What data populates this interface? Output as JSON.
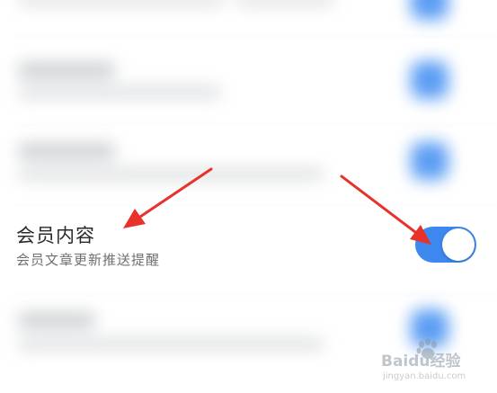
{
  "setting": {
    "title": "会员内容",
    "subtitle": "会员文章更新推送提醒",
    "enabled": true
  },
  "watermark": {
    "text": "Baidu经验",
    "subtext": "jingyan.baidu.com"
  },
  "colors": {
    "toggle_on": "#3c88ee",
    "arrow": "#e8312b",
    "title": "#2a2a2a",
    "subtitle": "#6f6f6f"
  },
  "icons": [
    "toggle-switch",
    "red-arrow",
    "baidu-paw-icon"
  ]
}
